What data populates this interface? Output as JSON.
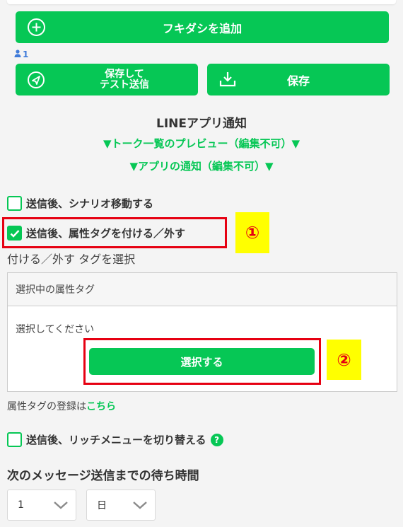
{
  "buttons": {
    "add_bubble": "フキダシを追加",
    "save_and_test": "保存して\nテスト送信",
    "save": "保存"
  },
  "user_count": "1",
  "section": {
    "title": "LINEアプリ通知",
    "talk_preview": "▼トーク一覧のプレビュー（編集不可）▼",
    "app_notice": "▼アプリの通知（編集不可）▼"
  },
  "options": {
    "scenario_move": "送信後、シナリオ移動する",
    "attr_tag": "送信後、属性タグを付ける／外す",
    "rich_menu": "送信後、リッチメニューを切り替える"
  },
  "tag_select": {
    "label": "付ける／外す タグを選択",
    "panel_header": "選択中の属性タグ",
    "placeholder": "選択してください",
    "select_button": "選択する",
    "register_prefix": "属性タグの登録は",
    "register_link": "こちら"
  },
  "annotations": {
    "marker_1": "①",
    "marker_2": "②"
  },
  "wait": {
    "title": "次のメッセージ送信までの待ち時間",
    "amount_value": "1",
    "unit_value": "日"
  },
  "help_glyph": "?",
  "colors": {
    "brand_green": "#06c755",
    "highlight_red": "#e60012",
    "badge_yellow": "#ffff00",
    "user_blue": "#3f7bd9"
  },
  "icons": [
    "plus-circle-icon",
    "user-icon",
    "send-icon",
    "download-icon",
    "check-icon",
    "help-icon",
    "chevron-down-icon"
  ]
}
